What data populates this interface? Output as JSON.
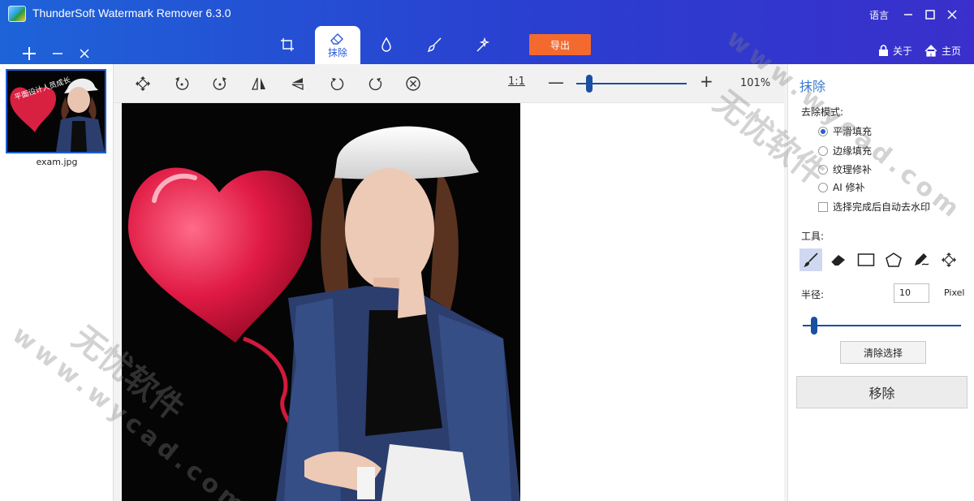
{
  "window": {
    "title": "ThunderSoft Watermark Remover 6.3.0",
    "language_label": "语言"
  },
  "file_actions": [
    "+",
    "−",
    "×"
  ],
  "mode_tabs": [
    {
      "id": "crop",
      "label": "",
      "icon": "crop-icon"
    },
    {
      "id": "erase",
      "label": "抹除",
      "icon": "eraser-icon",
      "active": true
    },
    {
      "id": "blur",
      "label": "",
      "icon": "drop-icon"
    },
    {
      "id": "brush",
      "label": "",
      "icon": "brush-icon"
    },
    {
      "id": "magic",
      "label": "",
      "icon": "magic-wand-icon"
    }
  ],
  "export_label": "导出",
  "top_links": {
    "about": "关于",
    "home": "主页"
  },
  "thumbnails": [
    {
      "name": "exam.jpg",
      "watermark_text": "平面设计人员成长"
    }
  ],
  "toolbar": {
    "ratio_label": "1:1",
    "zoom_percent": "101%",
    "zoom_level": 0.12
  },
  "panel": {
    "title": "抹除",
    "mode_label": "去除模式:",
    "modes": [
      {
        "label": "平滑填充",
        "selected": true
      },
      {
        "label": "边缘填充",
        "selected": false
      },
      {
        "label": "纹理修补",
        "selected": false
      },
      {
        "label": "AI 修补",
        "selected": false
      }
    ],
    "auto_remove_label": "选择完成后自动去水印",
    "tools_label": "工具:",
    "tools": [
      "brush-icon",
      "eraser-icon",
      "rectangle-icon",
      "polygon-icon",
      "pen-icon",
      "move-icon"
    ],
    "radius_label": "半径:",
    "radius_value": "10",
    "radius_unit": "Pixel",
    "radius_level": 0.07,
    "clear_label": "清除选择",
    "remove_label": "移除"
  },
  "overlay_watermark": {
    "text_cn": "无忧软件",
    "text_url": "www.wycad.com"
  },
  "colors": {
    "title_bar": "#2a4fd6",
    "accent": "#2a5bd7",
    "export": "#f46a2e",
    "slider": "#1b4fa3"
  }
}
